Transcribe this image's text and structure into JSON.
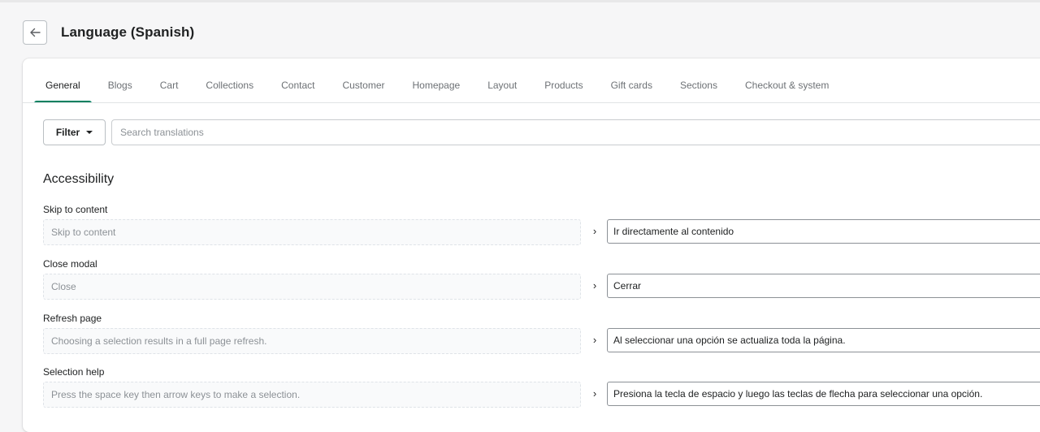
{
  "header": {
    "title": "Language (Spanish)",
    "back_icon": "arrow-left-icon"
  },
  "tabs": [
    {
      "label": "General",
      "active": true
    },
    {
      "label": "Blogs"
    },
    {
      "label": "Cart"
    },
    {
      "label": "Collections"
    },
    {
      "label": "Contact"
    },
    {
      "label": "Customer"
    },
    {
      "label": "Homepage"
    },
    {
      "label": "Layout"
    },
    {
      "label": "Products"
    },
    {
      "label": "Gift cards"
    },
    {
      "label": "Sections"
    },
    {
      "label": "Checkout & system"
    }
  ],
  "toolbar": {
    "filter_label": "Filter",
    "search_placeholder": "Search translations",
    "search_value": ""
  },
  "section": {
    "title": "Accessibility"
  },
  "rows": [
    {
      "label": "Skip to content",
      "source": "Skip to content",
      "translation": "Ir directamente al contenido"
    },
    {
      "label": "Close modal",
      "source": "Close",
      "translation": "Cerrar"
    },
    {
      "label": "Refresh page",
      "source": "Choosing a selection results in a full page refresh.",
      "translation": "Al seleccionar una opción se actualiza toda la página."
    },
    {
      "label": "Selection help",
      "source": "Press the space key then arrow keys to make a selection.",
      "translation": "Presiona la tecla de espacio y luego las teclas de flecha para seleccionar una opción."
    }
  ],
  "colors": {
    "accent": "#008060",
    "background": "#f6f6f7",
    "card": "#ffffff"
  }
}
